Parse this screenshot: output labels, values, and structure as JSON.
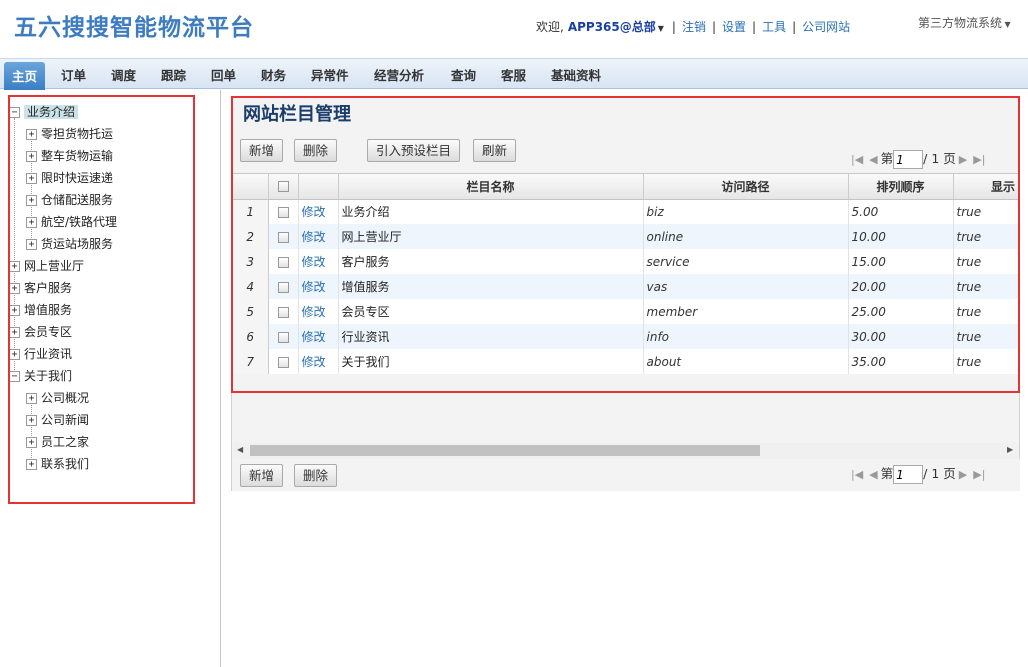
{
  "header": {
    "logo": "五六搜搜智能物流平台",
    "welcome": "欢迎,",
    "user": "APP365@总部",
    "links": [
      "注销",
      "设置",
      "工具",
      "公司网站"
    ],
    "system_menu": "第三方物流系统"
  },
  "menu": [
    "主页",
    "订单",
    "调度",
    "跟踪",
    "回单",
    "财务",
    "异常件",
    "经营分析",
    "查询",
    "客服",
    "基础资料"
  ],
  "tree": [
    {
      "label": "业务介绍",
      "toggle": "−",
      "level": 0,
      "selected": true
    },
    {
      "label": "零担货物托运",
      "toggle": "+",
      "level": 1
    },
    {
      "label": "整车货物运输",
      "toggle": "+",
      "level": 1
    },
    {
      "label": "限时快运速递",
      "toggle": "+",
      "level": 1
    },
    {
      "label": "仓储配送服务",
      "toggle": "+",
      "level": 1
    },
    {
      "label": "航空/铁路代理",
      "toggle": "+",
      "level": 1
    },
    {
      "label": "货运站场服务",
      "toggle": "+",
      "level": 1
    },
    {
      "label": "网上营业厅",
      "toggle": "+",
      "level": 0
    },
    {
      "label": "客户服务",
      "toggle": "+",
      "level": 0
    },
    {
      "label": "增值服务",
      "toggle": "+",
      "level": 0
    },
    {
      "label": "会员专区",
      "toggle": "+",
      "level": 0
    },
    {
      "label": "行业资讯",
      "toggle": "+",
      "level": 0
    },
    {
      "label": "关于我们",
      "toggle": "−",
      "level": 0
    },
    {
      "label": "公司概况",
      "toggle": "+",
      "level": 1
    },
    {
      "label": "公司新闻",
      "toggle": "+",
      "level": 1
    },
    {
      "label": "员工之家",
      "toggle": "+",
      "level": 1
    },
    {
      "label": "联系我们",
      "toggle": "+",
      "level": 1
    }
  ],
  "page_title": "网站栏目管理",
  "toolbar": {
    "add": "新增",
    "delete": "删除",
    "import": "引入预设栏目",
    "refresh": "刷新"
  },
  "pager": {
    "prefix": "第",
    "page": "1",
    "suffix": "/ 1 页"
  },
  "table": {
    "headers": [
      "栏目名称",
      "访问路径",
      "排列顺序",
      "显示"
    ],
    "edit_label": "修改",
    "rows": [
      {
        "no": "1",
        "name": "业务介绍",
        "path": "biz",
        "order": "5.00",
        "show": "true"
      },
      {
        "no": "2",
        "name": "网上营业厅",
        "path": "online",
        "order": "10.00",
        "show": "true"
      },
      {
        "no": "3",
        "name": "客户服务",
        "path": "service",
        "order": "15.00",
        "show": "true"
      },
      {
        "no": "4",
        "name": "增值服务",
        "path": "vas",
        "order": "20.00",
        "show": "true"
      },
      {
        "no": "5",
        "name": "会员专区",
        "path": "member",
        "order": "25.00",
        "show": "true"
      },
      {
        "no": "6",
        "name": "行业资讯",
        "path": "info",
        "order": "30.00",
        "show": "true"
      },
      {
        "no": "7",
        "name": "关于我们",
        "path": "about",
        "order": "35.00",
        "show": "true"
      }
    ]
  },
  "colors": {
    "accent": "#3b7ec4",
    "highlight": "#e53232",
    "link": "#2a6fb5"
  }
}
